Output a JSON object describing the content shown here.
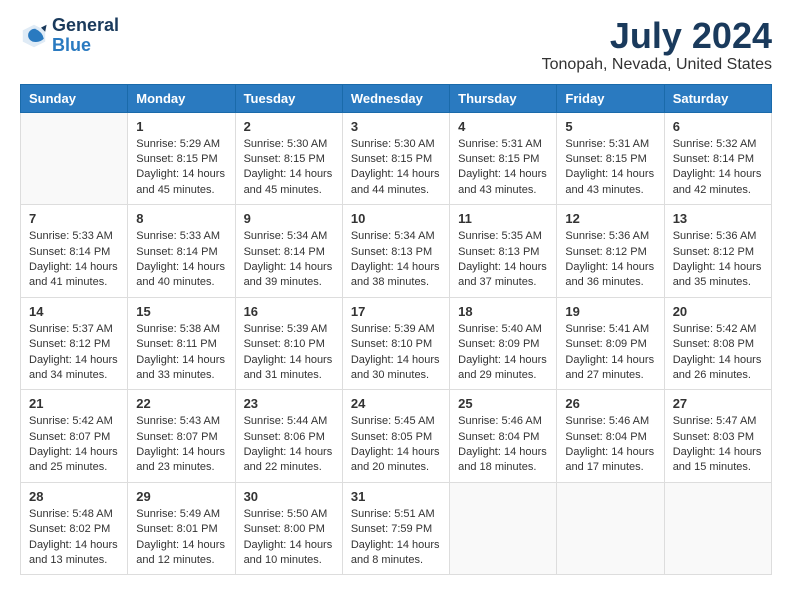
{
  "header": {
    "logo_line1": "General",
    "logo_line2": "Blue",
    "month": "July 2024",
    "location": "Tonopah, Nevada, United States"
  },
  "days_of_week": [
    "Sunday",
    "Monday",
    "Tuesday",
    "Wednesday",
    "Thursday",
    "Friday",
    "Saturday"
  ],
  "weeks": [
    [
      {
        "day": "",
        "lines": []
      },
      {
        "day": "1",
        "lines": [
          "Sunrise: 5:29 AM",
          "Sunset: 8:15 PM",
          "Daylight: 14 hours",
          "and 45 minutes."
        ]
      },
      {
        "day": "2",
        "lines": [
          "Sunrise: 5:30 AM",
          "Sunset: 8:15 PM",
          "Daylight: 14 hours",
          "and 45 minutes."
        ]
      },
      {
        "day": "3",
        "lines": [
          "Sunrise: 5:30 AM",
          "Sunset: 8:15 PM",
          "Daylight: 14 hours",
          "and 44 minutes."
        ]
      },
      {
        "day": "4",
        "lines": [
          "Sunrise: 5:31 AM",
          "Sunset: 8:15 PM",
          "Daylight: 14 hours",
          "and 43 minutes."
        ]
      },
      {
        "day": "5",
        "lines": [
          "Sunrise: 5:31 AM",
          "Sunset: 8:15 PM",
          "Daylight: 14 hours",
          "and 43 minutes."
        ]
      },
      {
        "day": "6",
        "lines": [
          "Sunrise: 5:32 AM",
          "Sunset: 8:14 PM",
          "Daylight: 14 hours",
          "and 42 minutes."
        ]
      }
    ],
    [
      {
        "day": "7",
        "lines": [
          "Sunrise: 5:33 AM",
          "Sunset: 8:14 PM",
          "Daylight: 14 hours",
          "and 41 minutes."
        ]
      },
      {
        "day": "8",
        "lines": [
          "Sunrise: 5:33 AM",
          "Sunset: 8:14 PM",
          "Daylight: 14 hours",
          "and 40 minutes."
        ]
      },
      {
        "day": "9",
        "lines": [
          "Sunrise: 5:34 AM",
          "Sunset: 8:14 PM",
          "Daylight: 14 hours",
          "and 39 minutes."
        ]
      },
      {
        "day": "10",
        "lines": [
          "Sunrise: 5:34 AM",
          "Sunset: 8:13 PM",
          "Daylight: 14 hours",
          "and 38 minutes."
        ]
      },
      {
        "day": "11",
        "lines": [
          "Sunrise: 5:35 AM",
          "Sunset: 8:13 PM",
          "Daylight: 14 hours",
          "and 37 minutes."
        ]
      },
      {
        "day": "12",
        "lines": [
          "Sunrise: 5:36 AM",
          "Sunset: 8:12 PM",
          "Daylight: 14 hours",
          "and 36 minutes."
        ]
      },
      {
        "day": "13",
        "lines": [
          "Sunrise: 5:36 AM",
          "Sunset: 8:12 PM",
          "Daylight: 14 hours",
          "and 35 minutes."
        ]
      }
    ],
    [
      {
        "day": "14",
        "lines": [
          "Sunrise: 5:37 AM",
          "Sunset: 8:12 PM",
          "Daylight: 14 hours",
          "and 34 minutes."
        ]
      },
      {
        "day": "15",
        "lines": [
          "Sunrise: 5:38 AM",
          "Sunset: 8:11 PM",
          "Daylight: 14 hours",
          "and 33 minutes."
        ]
      },
      {
        "day": "16",
        "lines": [
          "Sunrise: 5:39 AM",
          "Sunset: 8:10 PM",
          "Daylight: 14 hours",
          "and 31 minutes."
        ]
      },
      {
        "day": "17",
        "lines": [
          "Sunrise: 5:39 AM",
          "Sunset: 8:10 PM",
          "Daylight: 14 hours",
          "and 30 minutes."
        ]
      },
      {
        "day": "18",
        "lines": [
          "Sunrise: 5:40 AM",
          "Sunset: 8:09 PM",
          "Daylight: 14 hours",
          "and 29 minutes."
        ]
      },
      {
        "day": "19",
        "lines": [
          "Sunrise: 5:41 AM",
          "Sunset: 8:09 PM",
          "Daylight: 14 hours",
          "and 27 minutes."
        ]
      },
      {
        "day": "20",
        "lines": [
          "Sunrise: 5:42 AM",
          "Sunset: 8:08 PM",
          "Daylight: 14 hours",
          "and 26 minutes."
        ]
      }
    ],
    [
      {
        "day": "21",
        "lines": [
          "Sunrise: 5:42 AM",
          "Sunset: 8:07 PM",
          "Daylight: 14 hours",
          "and 25 minutes."
        ]
      },
      {
        "day": "22",
        "lines": [
          "Sunrise: 5:43 AM",
          "Sunset: 8:07 PM",
          "Daylight: 14 hours",
          "and 23 minutes."
        ]
      },
      {
        "day": "23",
        "lines": [
          "Sunrise: 5:44 AM",
          "Sunset: 8:06 PM",
          "Daylight: 14 hours",
          "and 22 minutes."
        ]
      },
      {
        "day": "24",
        "lines": [
          "Sunrise: 5:45 AM",
          "Sunset: 8:05 PM",
          "Daylight: 14 hours",
          "and 20 minutes."
        ]
      },
      {
        "day": "25",
        "lines": [
          "Sunrise: 5:46 AM",
          "Sunset: 8:04 PM",
          "Daylight: 14 hours",
          "and 18 minutes."
        ]
      },
      {
        "day": "26",
        "lines": [
          "Sunrise: 5:46 AM",
          "Sunset: 8:04 PM",
          "Daylight: 14 hours",
          "and 17 minutes."
        ]
      },
      {
        "day": "27",
        "lines": [
          "Sunrise: 5:47 AM",
          "Sunset: 8:03 PM",
          "Daylight: 14 hours",
          "and 15 minutes."
        ]
      }
    ],
    [
      {
        "day": "28",
        "lines": [
          "Sunrise: 5:48 AM",
          "Sunset: 8:02 PM",
          "Daylight: 14 hours",
          "and 13 minutes."
        ]
      },
      {
        "day": "29",
        "lines": [
          "Sunrise: 5:49 AM",
          "Sunset: 8:01 PM",
          "Daylight: 14 hours",
          "and 12 minutes."
        ]
      },
      {
        "day": "30",
        "lines": [
          "Sunrise: 5:50 AM",
          "Sunset: 8:00 PM",
          "Daylight: 14 hours",
          "and 10 minutes."
        ]
      },
      {
        "day": "31",
        "lines": [
          "Sunrise: 5:51 AM",
          "Sunset: 7:59 PM",
          "Daylight: 14 hours",
          "and 8 minutes."
        ]
      },
      {
        "day": "",
        "lines": []
      },
      {
        "day": "",
        "lines": []
      },
      {
        "day": "",
        "lines": []
      }
    ]
  ]
}
